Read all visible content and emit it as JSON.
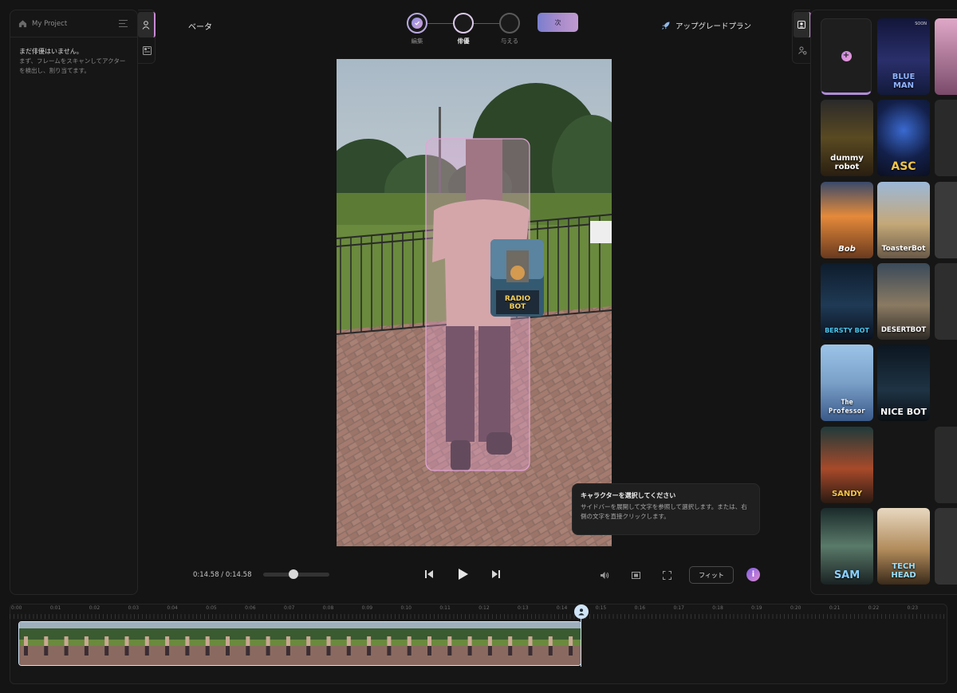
{
  "left_panel": {
    "project_name": "My Project",
    "no_actors_title": "まだ俳優はいません。",
    "no_actors_desc": "まず、フレームをスキャンしてアクターを検出し、割り当てます。"
  },
  "header": {
    "beta_label": "ベータ",
    "steps": [
      {
        "label": "編集",
        "state": "done"
      },
      {
        "label": "俳優",
        "state": "current"
      },
      {
        "label": "与える",
        "state": "pending"
      }
    ],
    "next_label": "次",
    "upgrade_label": "アップグレードプラン"
  },
  "tooltip": {
    "title": "キャラクターを選択してください",
    "body": "サイドバーを展開して文字を参照して選択します。または、右側の文字を直接クリックします。"
  },
  "player": {
    "time": "0:14.58 / 0:14.58",
    "fit_label": "フィット",
    "info_label": "i"
  },
  "characters": [
    {
      "name": "BLUE\nMAN",
      "badge": "SOON"
    },
    {
      "name": "dummy\nrobot"
    },
    {
      "name": "ASC"
    },
    {
      "name": "Bob"
    },
    {
      "name": "ToasterBot"
    },
    {
      "name": "BERSTY BOT"
    },
    {
      "name": "DESERTBOT"
    },
    {
      "name": "The\nProfessor"
    },
    {
      "name": "NICE BOT"
    },
    {
      "name": "SANDY"
    },
    {
      "name": "SAM"
    },
    {
      "name": "TECH\nHEAD"
    }
  ],
  "overlay_character": {
    "name": "RADIO\nBOT"
  },
  "timeline": {
    "tick_labels": [
      "0:00",
      "0:01",
      "0:02",
      "0:03",
      "0:04",
      "0:05",
      "0:06",
      "0:07",
      "0:08",
      "0:09",
      "0:10",
      "0:11",
      "0:12",
      "0:13",
      "0:14",
      "0:15",
      "0:16",
      "0:17",
      "0:18",
      "0:19",
      "0:20",
      "0:21",
      "0:22",
      "0:23"
    ]
  },
  "colors": {
    "accent_purple": "#c98bd6",
    "playhead": "#cfe4f7"
  }
}
